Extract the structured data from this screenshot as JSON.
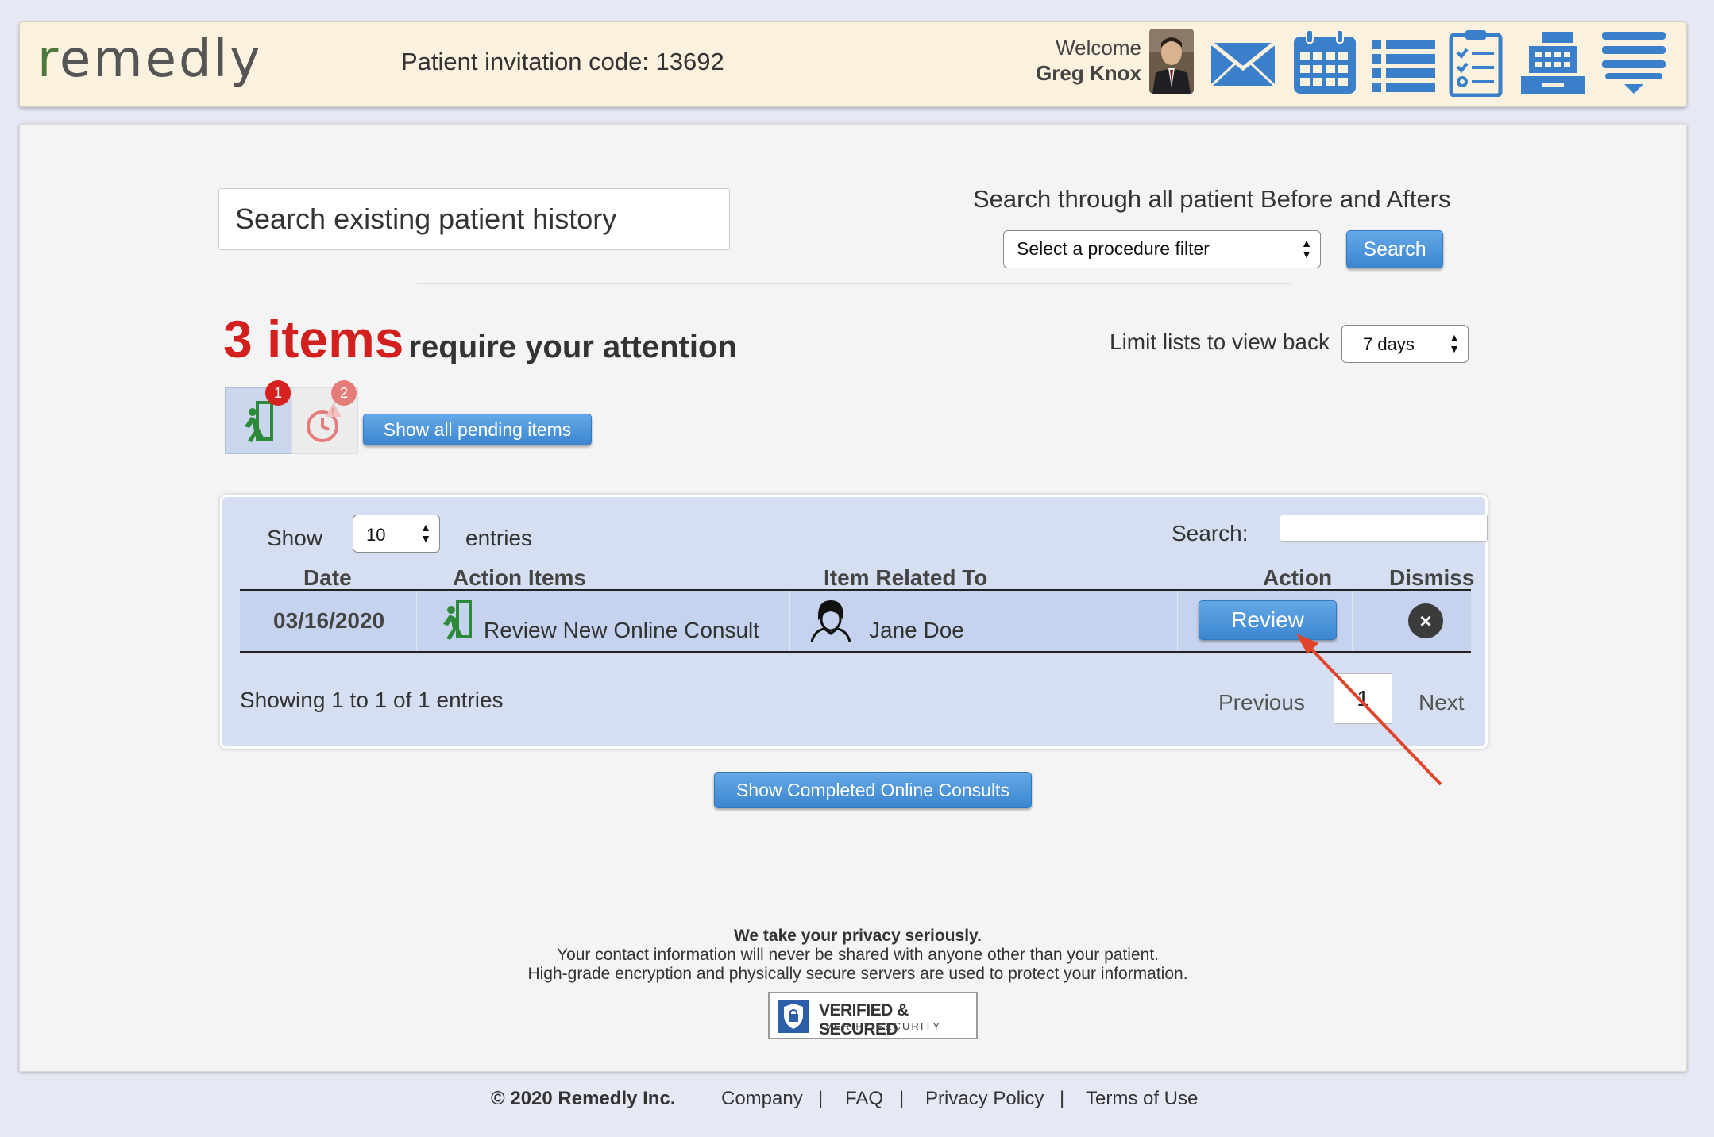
{
  "header": {
    "logo": "remedly",
    "invitation_code_text": "Patient invitation code: 13692",
    "welcome_label": "Welcome",
    "user_name": "Greg Knox",
    "icons": [
      "mail-icon",
      "calendar-icon",
      "list-icon",
      "checklist-icon",
      "cash-register-icon",
      "menu-icon"
    ]
  },
  "search": {
    "history_placeholder": "Search existing patient history",
    "before_afters_title": "Search through all patient Before and Afters",
    "procedure_filter": "Select a procedure filter",
    "search_button": "Search"
  },
  "attention": {
    "count": "3 items",
    "text": "require your attention",
    "limit_label": "Limit lists to view back",
    "limit_value": "7 days",
    "badges": [
      "1",
      "2"
    ],
    "pending_button": "Show all pending items"
  },
  "table": {
    "show_label": "Show",
    "entries_value": "10",
    "entries_label": "entries",
    "search_label": "Search:",
    "columns": [
      "Date",
      "Action Items",
      "Item Related To",
      "Action",
      "Dismiss"
    ],
    "rows": [
      {
        "date": "03/16/2020",
        "action_item": "Review New Online Consult",
        "related_to": "Jane Doe",
        "action_label": "Review"
      }
    ],
    "info": "Showing 1 to 1 of 1 entries",
    "previous": "Previous",
    "page": "1",
    "next": "Next"
  },
  "completed_button": "Show Completed Online Consults",
  "seal": {
    "title": "VERIFIED & SECURED",
    "subtitle": "VERIFY SECURITY"
  },
  "privacy": {
    "headline": "We take your privacy seriously.",
    "line1": "Your contact information will never be shared with anyone other than your patient.",
    "line2": "High-grade encryption and physically secure servers are used to protect your information."
  },
  "footer": {
    "copyright": "© 2020 Remedly Inc.",
    "links": [
      "Company",
      "FAQ",
      "Privacy Policy",
      "Terms of Use"
    ],
    "separator": "|"
  },
  "colors": {
    "accent_blue": "#3c86d0",
    "alert_red": "#d2201f",
    "header_bg": "#fbf1df",
    "table_bg": "#d6dff1",
    "arrow_red": "#e0452b"
  }
}
